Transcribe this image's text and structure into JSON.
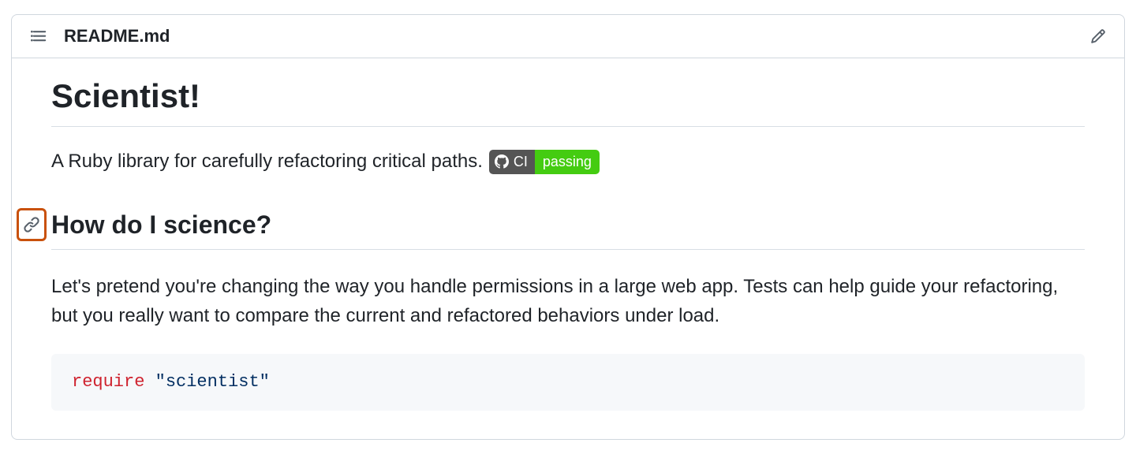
{
  "header": {
    "filename": "README.md"
  },
  "content": {
    "h1": "Scientist!",
    "tagline": "A Ruby library for carefully refactoring critical paths.",
    "badge": {
      "left_label": "CI",
      "right_label": "passing",
      "left_bg": "#555555",
      "right_bg": "#44cc11"
    },
    "h2": "How do I science?",
    "paragraph": "Let's pretend you're changing the way you handle permissions in a large web app. Tests can help guide your refactoring, but you really want to compare the current and refactored behaviors under load.",
    "code": {
      "keyword": "require",
      "string": "\"scientist\""
    }
  }
}
